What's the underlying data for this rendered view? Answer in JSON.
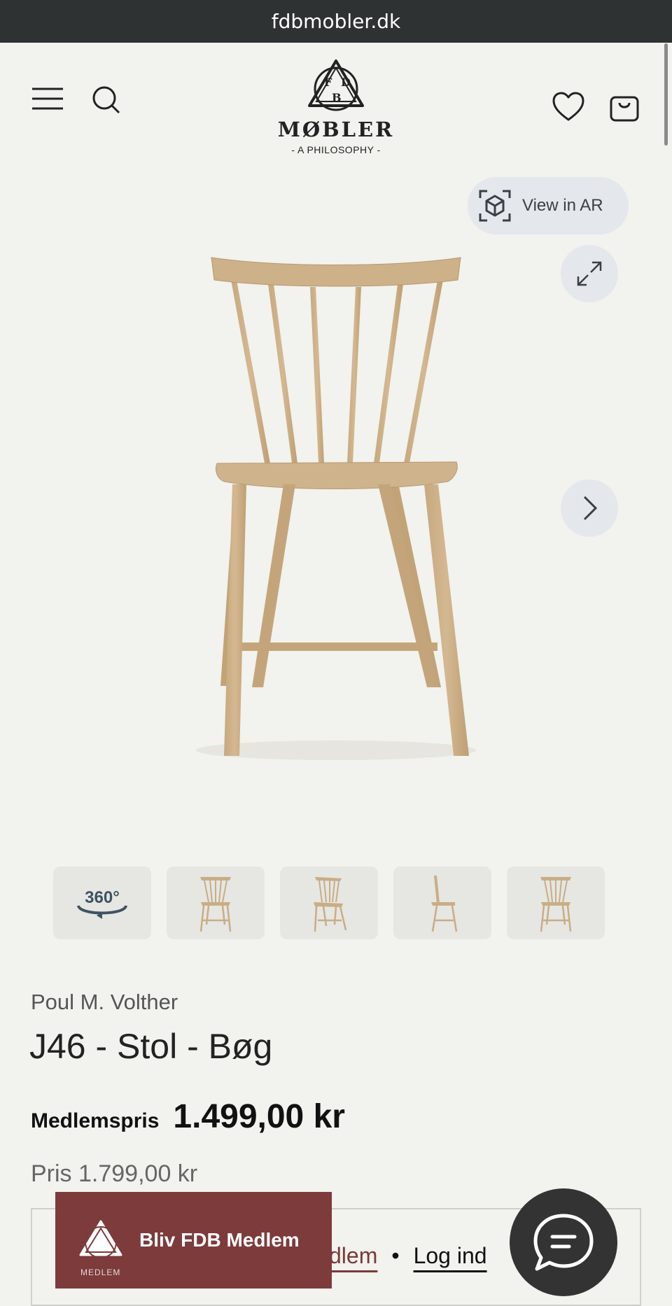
{
  "browser": {
    "url": "fdbmobler.dk"
  },
  "header": {
    "brand": "MØBLER",
    "tagline": "- A PHILOSOPHY -",
    "logo_letters": [
      "F",
      "D",
      "B"
    ]
  },
  "gallery": {
    "ar_label": "View in AR",
    "thumb_360_label": "360°",
    "thumbs": [
      "360-view",
      "front",
      "angle",
      "side",
      "back"
    ]
  },
  "product": {
    "designer": "Poul M. Volther",
    "title": "J46 - Stol - Bøg",
    "member_price_label": "Medlemspris",
    "member_price": "1.499,00 kr",
    "regular_price": "Pris 1.799,00 kr"
  },
  "login": {
    "member_link": "dlem",
    "separator": "•",
    "login_link": "Log ind"
  },
  "join_banner": {
    "label": "Bliv FDB Medlem",
    "sub": "MEDLEM"
  },
  "colors": {
    "background": "#f2f2ee",
    "urlbar": "#2e3232",
    "banner": "#7d3b3b",
    "chair_wood": "#c9ad86",
    "button_bg": "#e4e8ec"
  }
}
